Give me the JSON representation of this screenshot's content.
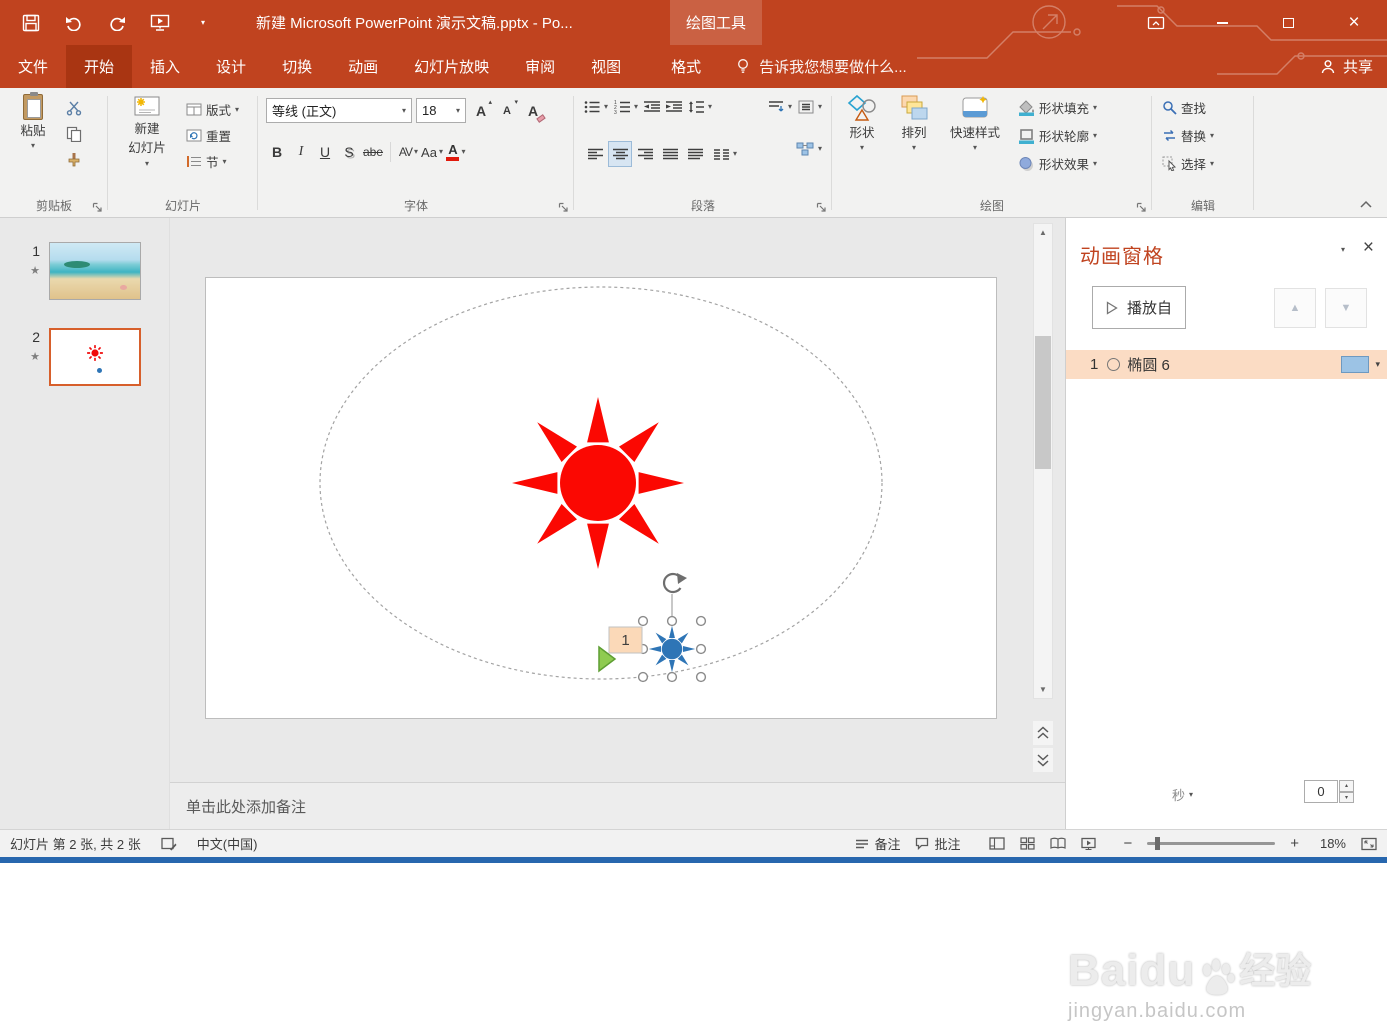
{
  "window": {
    "title": "新建 Microsoft PowerPoint 演示文稿.pptx - Po...",
    "context_tool": "绘图工具",
    "tell_me": "告诉我您想要做什么...",
    "share": "共享"
  },
  "tabs": [
    {
      "label": "文件"
    },
    {
      "label": "开始"
    },
    {
      "label": "插入"
    },
    {
      "label": "设计"
    },
    {
      "label": "切换"
    },
    {
      "label": "动画"
    },
    {
      "label": "幻灯片放映"
    },
    {
      "label": "审阅"
    },
    {
      "label": "视图"
    },
    {
      "label": "格式"
    }
  ],
  "ribbon": {
    "clipboard": {
      "group_label": "剪贴板",
      "paste": "粘贴"
    },
    "slides": {
      "group_label": "幻灯片",
      "new_slide_line1": "新建",
      "new_slide_line2": "幻灯片",
      "layout": "版式",
      "reset": "重置",
      "section": "节"
    },
    "font": {
      "group_label": "字体",
      "font_name": "等线 (正文)",
      "font_size": "18",
      "grow": "A",
      "shrink": "A",
      "clear": "A",
      "bold": "B",
      "italic": "I",
      "underline": "U",
      "shadow": "S",
      "strike": "abe",
      "spacing": "AV",
      "case": "Aa",
      "color": "A"
    },
    "paragraph": {
      "group_label": "段落"
    },
    "drawing": {
      "group_label": "绘图",
      "shapes": "形状",
      "arrange": "排列",
      "quick_styles": "快速样式",
      "shape_fill": "形状填充",
      "shape_outline": "形状轮廓",
      "shape_effects": "形状效果"
    },
    "editing": {
      "group_label": "编辑",
      "find": "查找",
      "replace": "替换",
      "select": "选择"
    }
  },
  "thumbnails": [
    {
      "number": "1"
    },
    {
      "number": "2"
    }
  ],
  "canvas": {
    "badge": "1"
  },
  "animation_pane": {
    "title": "动画窗格",
    "play_from": "播放自",
    "item_order": "1",
    "item_name": "椭圆 6",
    "seconds": "秒",
    "spinner": "0"
  },
  "notes": {
    "placeholder": "单击此处添加备注"
  },
  "status": {
    "slide_info": "幻灯片 第 2 张, 共 2 张",
    "language": "中文(中国)",
    "notes_label": "备注",
    "comments_label": "批注",
    "zoom_level": "18%"
  },
  "watermark": {
    "brand": "Baidu",
    "brand_suffix": "经验",
    "url": "jingyan.baidu.com"
  },
  "icons": {
    "caret-down": "▾",
    "close": "×",
    "star-indicator": "★",
    "scroll-up": "▲",
    "scroll-down": "▼",
    "zoom-out": "−",
    "zoom-in": "+"
  },
  "colors": {
    "titlebar_accent": "#C0431F",
    "active_tab": "#A93512",
    "sun_red": "#FB0802",
    "selected_shape_blue": "#2E75B6",
    "animation_item_highlight": "#FBDCC4",
    "timeline_bar_blue": "#9CC3E5",
    "selected_thumb_border": "#D75F2B",
    "taskbar_blue": "#2867AE"
  }
}
